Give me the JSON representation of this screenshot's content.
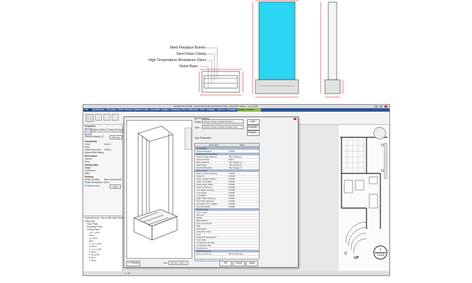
{
  "callouts": [
    "Steel Fireplace Burner",
    "Steel Glass Clamp",
    "High Temperature Resistance Glass",
    "Stone Base"
  ],
  "revit": {
    "title": "Standard Revit 2024 - Ras Al 456 Arabic Ahmadi Fire Files - Floor Plan: طابق ارضي - منطقة",
    "tabs": [
      "File",
      "Architecture",
      "Structure",
      "Steel",
      "Precast",
      "Systems",
      "Insert",
      "Annotate",
      "Analyze",
      "Massing & Site",
      "Collaborate",
      "View",
      "Manage",
      "Add-Ins",
      "Enscape™",
      "Modify | Generic Models"
    ],
    "active_tab": "Modify | Generic Models",
    "properties": {
      "header": "Properties",
      "family": "Modern Stone & Glass Fireplace",
      "sub": "Modern Stone & Glass Fireplace Modern Fireplace 1",
      "type_row": "Generic Models (1)",
      "edit_type": "Edit Type",
      "rows": [
        "Constraints",
        "Level",
        "Host",
        "Offset from Host",
        "Moves With Nearby",
        "Dimensions",
        "Volume",
        "Area",
        "Identity Data",
        "Image",
        "Comments",
        "Mark",
        "Phasing",
        "Phase Created",
        "Phase Demolished"
      ],
      "values": [
        "",
        "Level 1",
        "",
        "0.0000",
        "",
        "",
        "",
        "",
        "",
        "",
        "",
        "",
        "",
        "New Construction",
        "None"
      ],
      "help_link": "Properties help",
      "apply": "Apply"
    },
    "browser": {
      "header": "Project Browser - Ras Al 456 Arabic Ahmadi Fire Files",
      "items": [
        "Views (all)",
        "Floor Plans",
        "Structural Plans",
        "Ceiling Plans",
        "طابق ارضي",
        "منطقة",
        "طابق اول",
        "سطح",
        "طابق ارضي 1",
        "منطقة 2",
        "طابق ارضي 3",
        "منطقة 4",
        "طابق اول 5",
        "سطح 6",
        "منطقة 7"
      ]
    },
    "dialog": {
      "title": "Type Properties",
      "family_label": "Family:",
      "family_value": "Modern Stone & Glass Fireplace",
      "type_label": "Type:",
      "type_value": "Modern Stone & Glass Fireplace Mod",
      "load_btn": "Load...",
      "duplicate_btn": "Duplicate...",
      "rename_btn": "Rename...",
      "type_params_label": "Type Parameters",
      "col_param": "Parameter",
      "col_value": "Value",
      "rows": [
        {
          "h": "Constraints"
        },
        {
          "p": "Default Elevation",
          "v": "0.0000"
        },
        {
          "h": "Materials and Finishes"
        },
        {
          "p": "Glass Design Material",
          "v": "<By Category>"
        },
        {
          "p": "Glass Position",
          "v": "Glass"
        },
        {
          "p": "Base Material",
          "v": "<By Category>"
        },
        {
          "p": "Steel Plate",
          "v": "<By Category>"
        },
        {
          "p": "Top Roll Material",
          "v": "<By Category>"
        },
        {
          "h": "Dimensions"
        },
        {
          "p": "Bottom Offset Spacing",
          "v": "0.2000"
        },
        {
          "p": "Glass Ht",
          "v": "2.0000"
        },
        {
          "p": "Glass Height Position",
          "v": "0.0000"
        },
        {
          "p": "Glass Left Offset",
          "v": "0.0000"
        },
        {
          "p": "Glass Right Offset",
          "v": "0.0000"
        },
        {
          "p": "Glass Thickness",
          "v": "0.0100"
        },
        {
          "p": "Left Offset Spacing",
          "v": "0.2000"
        },
        {
          "p": "Leg Height",
          "v": "0.2000"
        },
        {
          "p": "Leg Width",
          "v": "0.2000"
        },
        {
          "p": "Right Offset Spacing",
          "v": "0.2000"
        },
        {
          "p": "Top Offset Spacing",
          "v": "0.2000"
        },
        {
          "p": "Top Roll & Tmx Height",
          "v": "0.2000"
        },
        {
          "p": "Top Roll Width",
          "v": "0.2000"
        },
        {
          "h": "Identity Data"
        },
        {
          "p": "Type Image",
          "v": ""
        },
        {
          "p": "Keynote",
          "v": ""
        },
        {
          "p": "Model",
          "v": ""
        },
        {
          "p": "Manufacturer",
          "v": ""
        },
        {
          "p": "Type Comments",
          "v": ""
        },
        {
          "p": "URL",
          "v": ""
        },
        {
          "p": "Description",
          "v": ""
        },
        {
          "p": "Assembly Code",
          "v": ""
        },
        {
          "p": "Cost",
          "v": ""
        },
        {
          "p": "Assembly Description",
          "v": ""
        },
        {
          "p": "Type Mark",
          "v": ""
        },
        {
          "p": "OmniClass Number",
          "v": ""
        },
        {
          "p": "OmniClass Title",
          "v": ""
        },
        {
          "p": "Code Name",
          "v": ""
        },
        {
          "h": "IFC Parameters"
        },
        {
          "p": "Export to IFC As",
          "v": "IfcFurnitureType"
        }
      ],
      "help_link": "How do these properties work?",
      "view_label": "View:",
      "view_value": "3D View: View 1",
      "preview_btn": "<< Preview",
      "ok_btn": "OK",
      "cancel_btn": "Cancel",
      "apply_btn": "Apply"
    },
    "plan": {
      "up_label": "UP",
      "tag_number": "1",
      "tag_sheet": "A114"
    },
    "zoom_readout": "1 : 50"
  }
}
